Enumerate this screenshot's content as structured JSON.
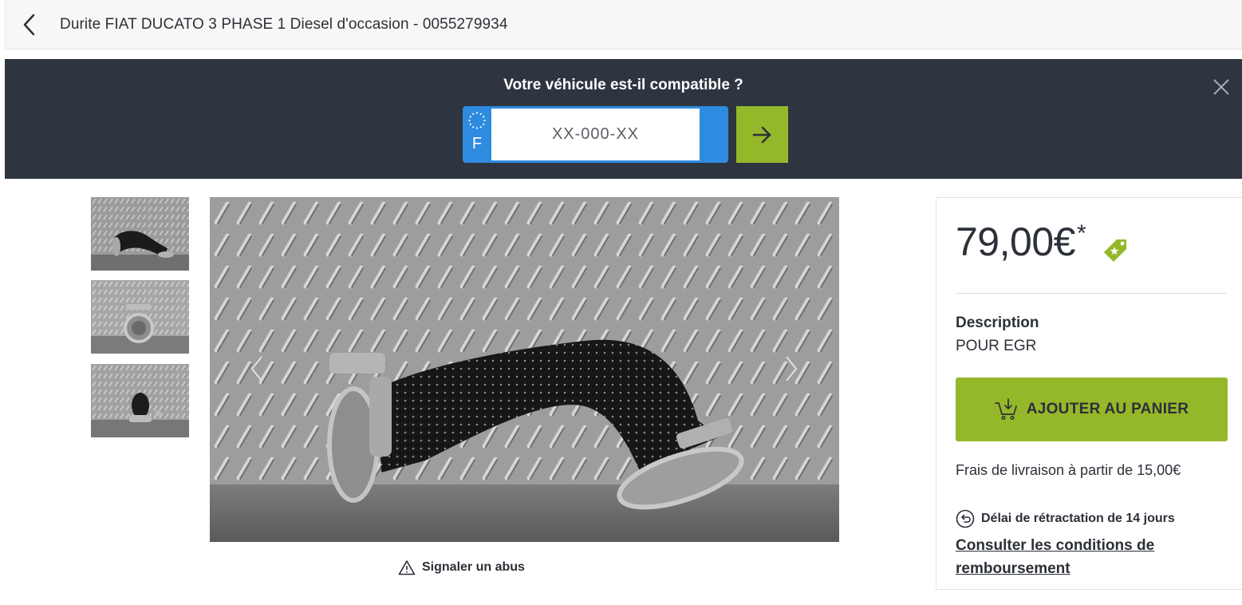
{
  "header": {
    "title": "Durite FIAT DUCATO 3 PHASE 1 Diesel d'occasion - 0055279934",
    "back_icon": "chevron-left-icon"
  },
  "compat_banner": {
    "title": "Votre véhicule est-il compatible ?",
    "plate_country": "F",
    "plate_placeholder": "XX-000-XX",
    "plate_value": "",
    "submit_icon": "arrow-right-icon",
    "close_icon": "close-icon",
    "colors": {
      "background": "#2e3540",
      "plate": "#2f8be0",
      "submit": "#95b82a"
    }
  },
  "gallery": {
    "thumbnails": [
      {
        "icon": "product-thumbnail-side-view"
      },
      {
        "icon": "product-thumbnail-front-view"
      },
      {
        "icon": "product-thumbnail-end-view"
      }
    ],
    "main_image": "product-photo-egr-hose",
    "prev_icon": "chevron-left-icon",
    "next_icon": "chevron-right-icon",
    "report_label": "Signaler un abus",
    "report_icon": "warning-icon"
  },
  "product": {
    "price": "79,00€",
    "price_asterisk": "*",
    "price_tag_icon": "star-tag-icon",
    "description_label": "Description",
    "description_value": "POUR EGR",
    "add_to_cart_label": "AJOUTER AU PANIER",
    "add_to_cart_icon": "cart-add-icon",
    "shipping_text": "Frais de livraison à partir de 15,00€",
    "retraction_label": "Délai de rétractation de 14 jours",
    "retraction_icon": "return-arrow-icon",
    "refund_link": "Consulter les conditions de remboursement",
    "colors": {
      "accent": "#95b82a",
      "text": "#2c3038"
    }
  }
}
